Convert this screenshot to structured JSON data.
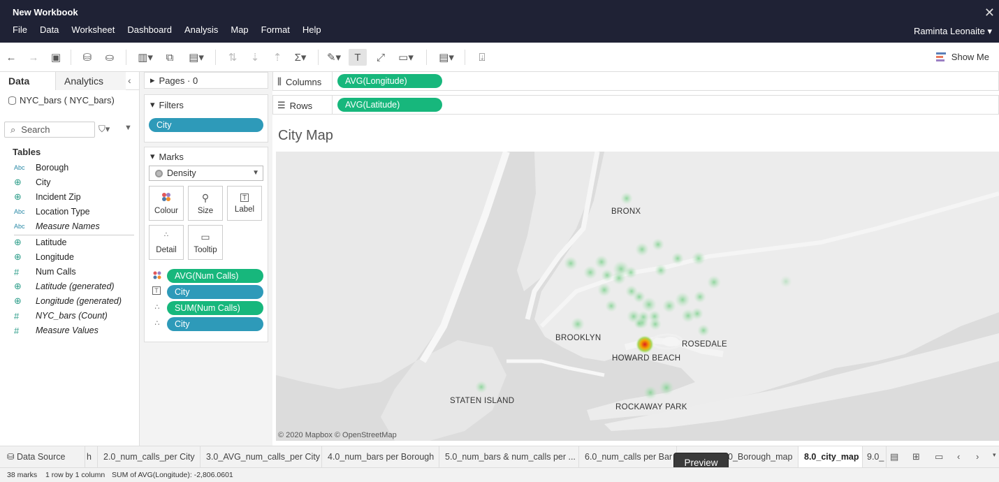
{
  "window": {
    "title": "New Workbook",
    "user": "Raminta Leonaite"
  },
  "menu": [
    "File",
    "Data",
    "Worksheet",
    "Dashboard",
    "Analysis",
    "Map",
    "Format",
    "Help"
  ],
  "toolbar": {
    "show_me": "Show Me"
  },
  "data_pane": {
    "tabs": {
      "data": "Data",
      "analytics": "Analytics"
    },
    "datasource": "NYC_bars ( NYC_bars)",
    "search_placeholder": "Search",
    "tables_heading": "Tables",
    "dimensions": [
      {
        "type": "Abc",
        "name": "Borough"
      },
      {
        "type": "globe",
        "name": "City"
      },
      {
        "type": "globe",
        "name": "Incident Zip"
      },
      {
        "type": "Abc",
        "name": "Location Type"
      },
      {
        "type": "Abc",
        "name": "Measure Names",
        "italic": true
      }
    ],
    "measures": [
      {
        "type": "globe",
        "name": "Latitude"
      },
      {
        "type": "globe",
        "name": "Longitude"
      },
      {
        "type": "#",
        "name": "Num Calls"
      },
      {
        "type": "globe",
        "name": "Latitude (generated)",
        "italic": true
      },
      {
        "type": "globe",
        "name": "Longitude (generated)",
        "italic": true
      },
      {
        "type": "#",
        "name": "NYC_bars (Count)",
        "italic": true
      },
      {
        "type": "#",
        "name": "Measure Values",
        "italic": true
      }
    ]
  },
  "pages": {
    "label": "Pages · 0"
  },
  "filters": {
    "label": "Filters",
    "items": [
      "City"
    ]
  },
  "marks": {
    "label": "Marks",
    "type": "Density",
    "buttons": {
      "colour": "Colour",
      "size": "Size",
      "label": "Label",
      "detail": "Detail",
      "tooltip": "Tooltip"
    },
    "fields": [
      {
        "icon": "colour",
        "name": "AVG(Num Calls)",
        "color": "green"
      },
      {
        "icon": "label",
        "name": "City",
        "color": "blue"
      },
      {
        "icon": "detail",
        "name": "SUM(Num Calls)",
        "color": "green"
      },
      {
        "icon": "detail",
        "name": "City",
        "color": "blue"
      }
    ]
  },
  "shelves": {
    "columns_label": "Columns",
    "columns_pill": "AVG(Longitude)",
    "rows_label": "Rows",
    "rows_pill": "AVG(Latitude)"
  },
  "viz": {
    "title": "City Map",
    "labels": {
      "bronx": "BRONX",
      "brooklyn": "BROOKLYN",
      "rosedale": "ROSEDALE",
      "howard_beach": "HOWARD BEACH",
      "staten_island": "STATEN ISLAND",
      "rockaway_park": "ROCKAWAY PARK"
    },
    "attribution": "© 2020 Mapbox  © OpenStreetMap"
  },
  "sheet_tabs": {
    "data_source": "Data Source",
    "tabs": [
      "h",
      "2.0_num_calls_per City",
      "3.0_AVG_num_calls_per City",
      "4.0_num_bars per Borough",
      "5.0_num_bars & num_calls per ...",
      "6.0_num_calls per Bar",
      "0_Borough_map",
      "8.0_city_map",
      "9.0_"
    ],
    "active": "8.0_city_map",
    "tooltip": "Preview"
  },
  "status": {
    "marks": "38 marks",
    "dims": "1 row by 1 column",
    "sum": "SUM of AVG(Longitude): -2,806.0601"
  },
  "colors": {
    "header_bg": "#1f2235",
    "green_pill": "#17b77c",
    "blue_pill": "#2e9ab9"
  }
}
